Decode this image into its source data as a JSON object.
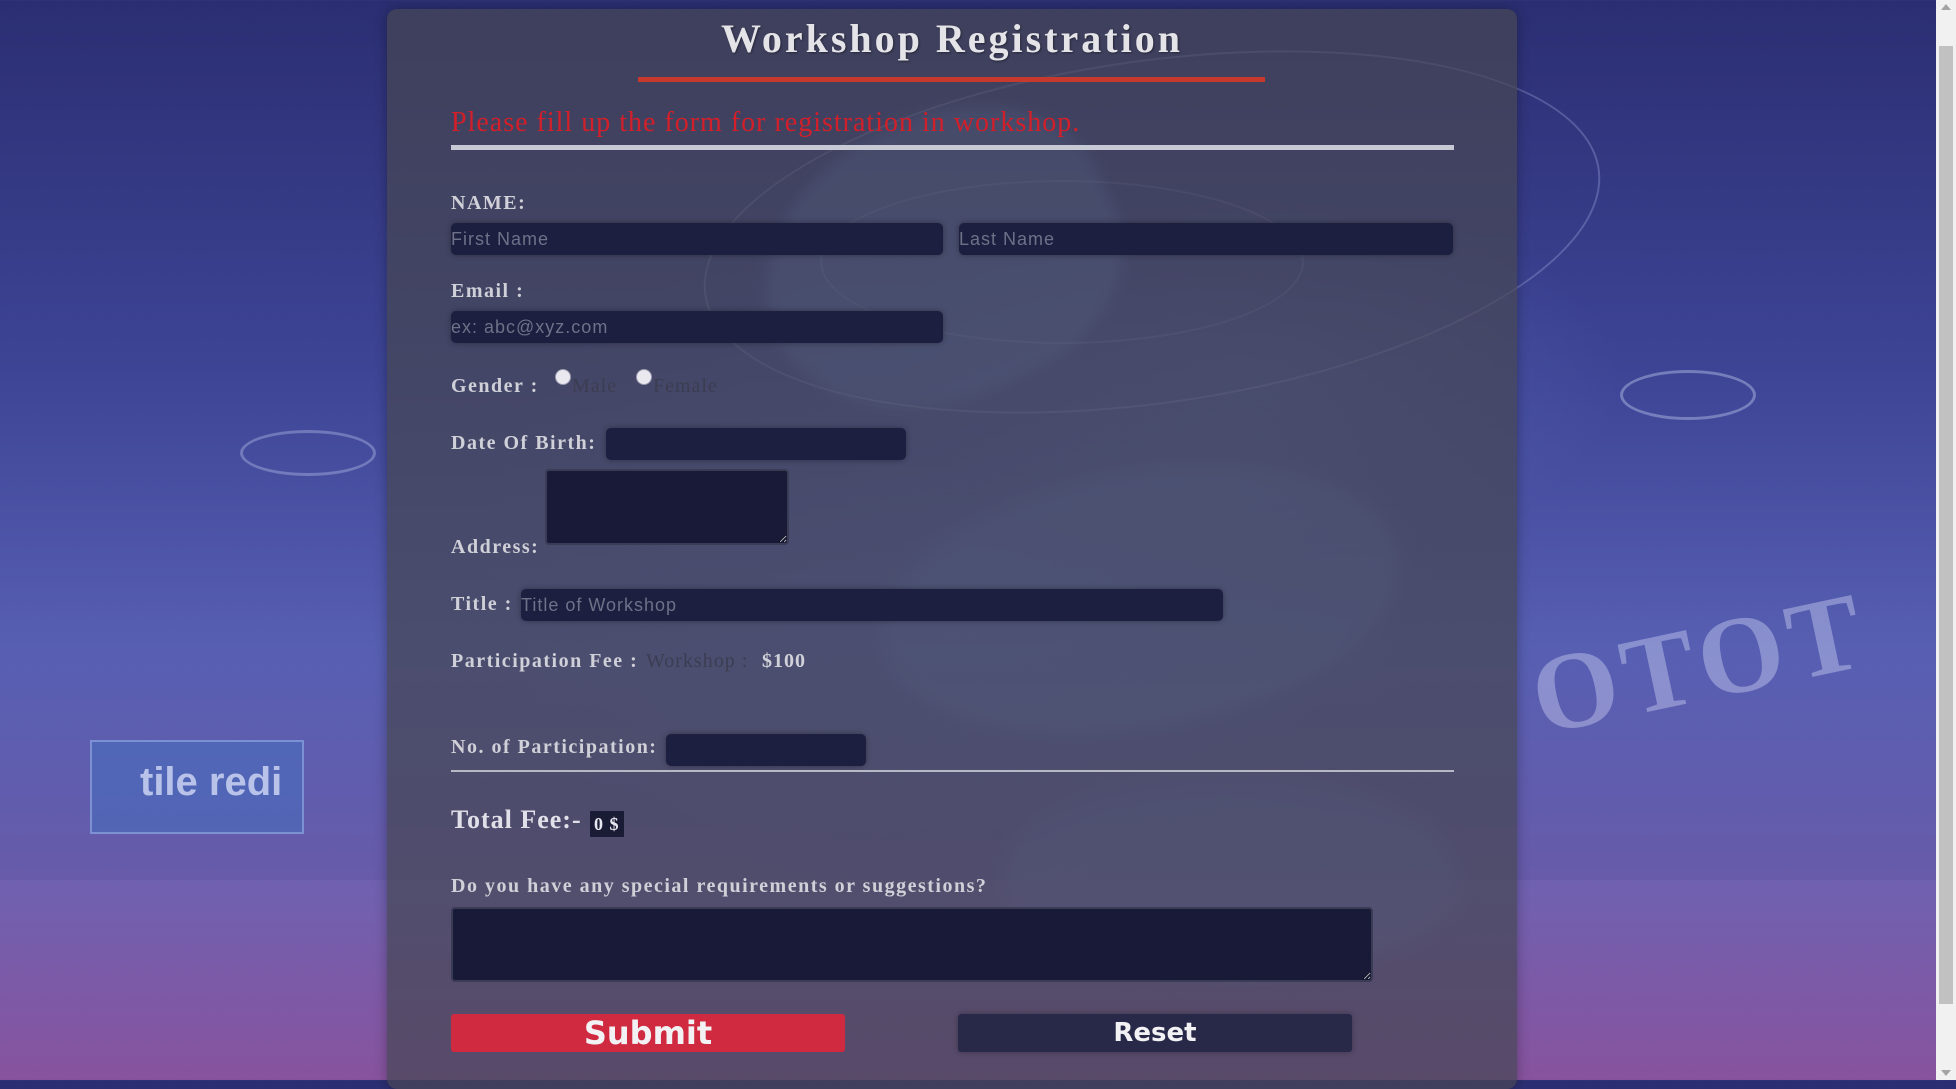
{
  "page": {
    "title": "Workshop Registration",
    "intro": "Please fill up the form for registration in workshop."
  },
  "form": {
    "name_label": "NAME:",
    "first_name_placeholder": "First Name",
    "last_name_placeholder": "Last Name",
    "email_label": "Email :",
    "email_placeholder": "ex: abc@xyz.com",
    "gender_label": "Gender :",
    "gender_male": "Male",
    "gender_female": "Female",
    "dob_label": "Date Of Birth:",
    "address_label": "Address:",
    "title_label": "Title :",
    "title_placeholder": "Title of Workshop",
    "fee_label": "Participation Fee :",
    "fee_item": "Workshop :",
    "fee_value": "$100",
    "participants_label": "No. of Participation:",
    "total_label": "Total Fee:-",
    "total_value": "0 $",
    "requirements_label": "Do you have any special requirements or suggestions?",
    "submit_label": "Submit",
    "reset_label": "Reset"
  },
  "background": {
    "sign_text": "OTOT",
    "booth_text": "tile redi"
  },
  "colors": {
    "accent": "#d02a40",
    "title_underline": "#c8392d",
    "intro_text": "#d21f2a",
    "input_bg": "#1c1f3f"
  }
}
